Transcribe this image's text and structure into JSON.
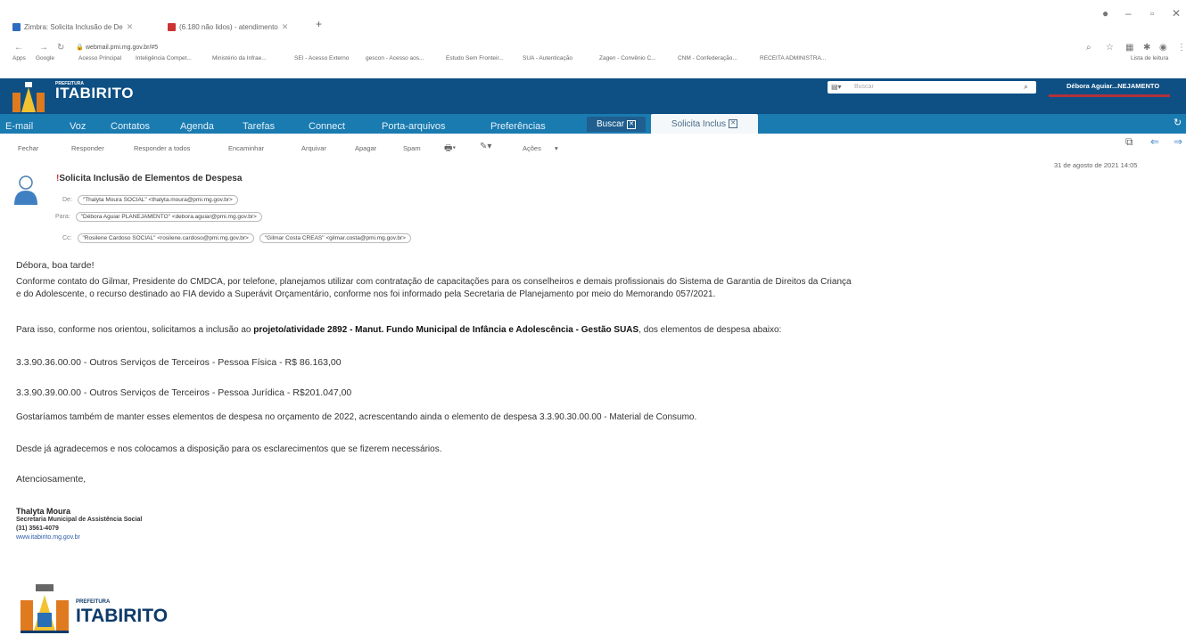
{
  "browser": {
    "tabs": [
      {
        "label": "Zimbra: Solicita Inclusão de De"
      },
      {
        "label": "(6.180 não lidos) - atendimento"
      }
    ],
    "url": "webmail.pmi.mg.gov.br/#5",
    "bookmarks": [
      "Apps",
      "Google",
      "Acesso Principal",
      "Inteligência Compet...",
      "Ministério da Infrae...",
      "SEI - Acesso Externo",
      "gescon - Acesso aos...",
      "Estudo Sem Fronteir...",
      "SUA - Autenticação",
      "Zagen - Convênio C...",
      "CNM - Confederação...",
      "RECEITA ADMINISTRA..."
    ],
    "reading_list": "Lista de leitura"
  },
  "app": {
    "logo_prefix": "PREFEITURA",
    "logo_name": "ITABIRITO",
    "search_placeholder": "Buscar",
    "user": "Débora Aguiar...NEJAMENTO",
    "menu": [
      "E-mail",
      "Voz",
      "Contatos",
      "Agenda",
      "Tarefas",
      "Connect",
      "Porta-arquivos",
      "Preferências"
    ],
    "tab_buscar": "Buscar",
    "tab_solicita": "Solicita Inclus",
    "toolbar": [
      "Fechar",
      "Responder",
      "Responder a todos",
      "Encaminhar",
      "Arquivar",
      "Apagar",
      "Spam",
      "Ações"
    ]
  },
  "message": {
    "subject": "Solicita Inclusão de Elementos de Despesa",
    "date": "31 de agosto de 2021 14:05",
    "from_label": "De:",
    "from": "\"Thalyta Moura SOCIAL\" <thalyta.moura@pmi.mg.gov.br>",
    "to_label": "Para:",
    "to": "\"Débora Aguiar PLANEJAMENTO\" <debora.aguiar@pmi.mg.gov.br>",
    "cc_label": "Cc:",
    "cc": [
      "\"Rosilene Cardoso SOCIAL\" <rosilene.cardoso@pmi.mg.gov.br>",
      "\"Gilmar Costa CREAS\" <gilmar.costa@pmi.mg.gov.br>"
    ],
    "greeting": "Débora, boa tarde!",
    "p1_line1": "Conforme contato do Gilmar, Presidente do CMDCA, por telefone, planejamos utilizar com contratação de capacitações para os conselheiros e demais profissionais do Sistema de Garantia de Direitos da Criança",
    "p1_line2": "e do Adolescente, o recurso destinado ao FIA devido a Superávit Orçamentário, conforme nos foi informado pela Secretaria de Planejamento por meio do Memorando 057/2021.",
    "p2_pre": "Para isso, conforme nos orientou, solicitamos a inclusão ao ",
    "p2_bold": "projeto/atividade 2892 - Manut. Fundo Municipal de Infância e Adolescência - Gestão SUAS",
    "p2_post": ", dos elementos de despesa abaixo:",
    "item1": "3.3.90.36.00.00 - Outros Serviços de Terceiros - Pessoa Física - R$ 86.163,00",
    "item2": "3.3.90.39.00.00 - Outros Serviços de Terceiros - Pessoa Jurídica - R$201.047,00",
    "p3": "Gostaríamos também de manter esses elementos de despesa no orçamento de 2022, acrescentando ainda o elemento de despesa 3.3.90.30.00.00 - Material de Consumo.",
    "p4": "Desde já agradecemos e nos colocamos a disposição para os esclarecimentos que se fizerem necessários.",
    "closing": "Atenciosamente,",
    "sig_name": "Thalyta Moura",
    "sig_role": "Secretaria Municipal de Assistência Social",
    "sig_phone": "(31) 3561-4079",
    "sig_url": "www.itabirito.mg.gov.br",
    "sig_logo_prefix": "PREFEITURA",
    "sig_logo_name": "ITABIRITO"
  },
  "colors": {
    "header": "#0e4f84",
    "menu": "#1a7bb0",
    "accent_red": "#b0323a"
  }
}
